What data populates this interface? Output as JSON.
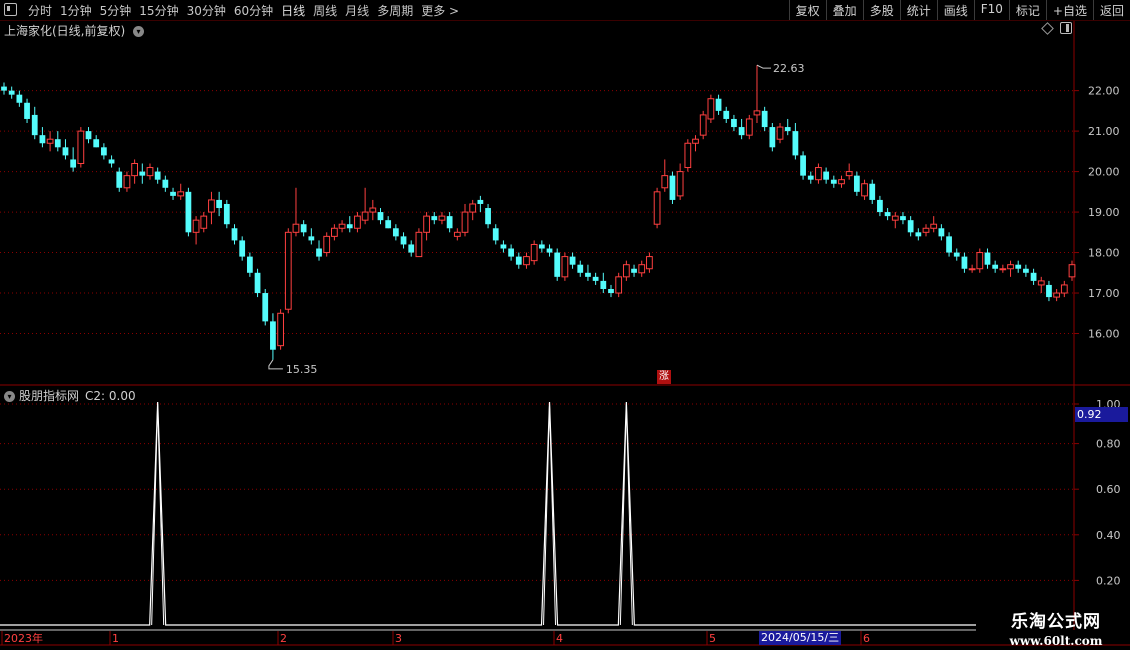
{
  "toolbar": {
    "periods": [
      "分时",
      "1分钟",
      "5分钟",
      "15分钟",
      "30分钟",
      "60分钟",
      "日线",
      "周线",
      "月线",
      "多周期"
    ],
    "active_period": "日线",
    "more_label": "更多 >",
    "tools": [
      "复权",
      "叠加",
      "多股",
      "统计",
      "画线",
      "F10",
      "标记",
      "+自选",
      "返回"
    ]
  },
  "stock_title": "上海家化(日线,前复权)",
  "indicator": {
    "name": "股朋指标网",
    "c2_label": "C2: 0.00"
  },
  "right_badge": "0.92",
  "zhang_label": "涨",
  "watermark": {
    "line1": "乐淘公式网",
    "line2": "www.60lt.com"
  },
  "cursor_date": "2024/05/15/三",
  "colors": {
    "up": "#ff4040",
    "down": "#54fcfc",
    "grid": "#8b0000",
    "axis": "#8b0000",
    "signal": "#ffffff"
  },
  "chart_data": [
    {
      "type": "candlestick",
      "title": "上海家化(日线,前复权)",
      "ylim": [
        15.0,
        23.3
      ],
      "y_ticks": [
        "16.00",
        "17.00",
        "18.00",
        "19.00",
        "20.00",
        "21.00",
        "22.00"
      ],
      "grid": true,
      "annotations": {
        "max": "22.63",
        "min": "15.35"
      },
      "ohlc": [
        [
          22.1,
          22.2,
          21.9,
          22.0
        ],
        [
          22.0,
          22.1,
          21.8,
          21.9
        ],
        [
          21.9,
          22.0,
          21.6,
          21.7
        ],
        [
          21.7,
          21.8,
          21.2,
          21.3
        ],
        [
          21.4,
          21.6,
          20.8,
          20.9
        ],
        [
          20.9,
          21.1,
          20.6,
          20.7
        ],
        [
          20.7,
          21.0,
          20.5,
          20.8
        ],
        [
          20.8,
          21.0,
          20.5,
          20.6
        ],
        [
          20.6,
          20.8,
          20.3,
          20.4
        ],
        [
          20.3,
          20.6,
          20.0,
          20.1
        ],
        [
          20.2,
          21.1,
          20.1,
          21.0
        ],
        [
          21.0,
          21.1,
          20.7,
          20.8
        ],
        [
          20.8,
          20.9,
          20.6,
          20.6
        ],
        [
          20.6,
          20.7,
          20.3,
          20.4
        ],
        [
          20.3,
          20.4,
          20.1,
          20.2
        ],
        [
          20.0,
          20.1,
          19.5,
          19.6
        ],
        [
          19.6,
          20.0,
          19.5,
          19.9
        ],
        [
          19.9,
          20.3,
          19.7,
          20.2
        ],
        [
          20.0,
          20.2,
          19.7,
          19.9
        ],
        [
          19.9,
          20.2,
          19.8,
          20.1
        ],
        [
          20.0,
          20.1,
          19.7,
          19.8
        ],
        [
          19.8,
          19.9,
          19.5,
          19.6
        ],
        [
          19.5,
          19.6,
          19.3,
          19.4
        ],
        [
          19.4,
          19.7,
          19.3,
          19.5
        ],
        [
          19.5,
          19.6,
          18.4,
          18.5
        ],
        [
          18.5,
          18.9,
          18.2,
          18.8
        ],
        [
          18.6,
          19.0,
          18.5,
          18.9
        ],
        [
          19.0,
          19.5,
          18.7,
          19.3
        ],
        [
          19.3,
          19.5,
          18.9,
          19.1
        ],
        [
          19.2,
          19.3,
          18.6,
          18.7
        ],
        [
          18.6,
          18.7,
          18.2,
          18.3
        ],
        [
          18.3,
          18.4,
          17.8,
          17.9
        ],
        [
          17.9,
          18.0,
          17.4,
          17.5
        ],
        [
          17.5,
          17.6,
          16.9,
          17.0
        ],
        [
          17.0,
          17.1,
          16.2,
          16.3
        ],
        [
          16.3,
          16.5,
          15.35,
          15.6
        ],
        [
          15.7,
          16.6,
          15.6,
          16.5
        ],
        [
          16.6,
          18.6,
          16.5,
          18.5
        ],
        [
          18.5,
          19.6,
          18.4,
          18.7
        ],
        [
          18.7,
          18.8,
          18.4,
          18.5
        ],
        [
          18.4,
          18.6,
          18.2,
          18.3
        ],
        [
          18.1,
          18.3,
          17.8,
          17.9
        ],
        [
          18.0,
          18.5,
          17.9,
          18.4
        ],
        [
          18.4,
          18.7,
          18.3,
          18.6
        ],
        [
          18.6,
          18.8,
          18.5,
          18.7
        ],
        [
          18.7,
          18.9,
          18.5,
          18.6
        ],
        [
          18.6,
          19.0,
          18.5,
          18.9
        ],
        [
          18.8,
          19.6,
          18.7,
          19.0
        ],
        [
          19.0,
          19.3,
          18.8,
          19.1
        ],
        [
          19.0,
          19.1,
          18.7,
          18.8
        ],
        [
          18.8,
          18.9,
          18.6,
          18.6
        ],
        [
          18.6,
          18.7,
          18.3,
          18.4
        ],
        [
          18.4,
          18.5,
          18.1,
          18.2
        ],
        [
          18.2,
          18.3,
          17.9,
          18.0
        ],
        [
          17.9,
          18.6,
          17.9,
          18.5
        ],
        [
          18.5,
          19.0,
          18.3,
          18.9
        ],
        [
          18.9,
          19.0,
          18.7,
          18.8
        ],
        [
          18.8,
          19.0,
          18.7,
          18.9
        ],
        [
          18.9,
          19.0,
          18.5,
          18.6
        ],
        [
          18.4,
          18.6,
          18.3,
          18.5
        ],
        [
          18.5,
          19.2,
          18.4,
          19.0
        ],
        [
          19.0,
          19.3,
          18.8,
          19.2
        ],
        [
          19.3,
          19.4,
          19.0,
          19.2
        ],
        [
          19.1,
          19.2,
          18.6,
          18.7
        ],
        [
          18.6,
          18.7,
          18.2,
          18.3
        ],
        [
          18.2,
          18.3,
          18.0,
          18.1
        ],
        [
          18.1,
          18.2,
          17.8,
          17.9
        ],
        [
          17.9,
          18.0,
          17.6,
          17.7
        ],
        [
          17.7,
          18.0,
          17.6,
          17.9
        ],
        [
          17.8,
          18.3,
          17.7,
          18.2
        ],
        [
          18.2,
          18.3,
          18.0,
          18.1
        ],
        [
          18.1,
          18.2,
          17.9,
          18.0
        ],
        [
          18.0,
          18.1,
          17.3,
          17.4
        ],
        [
          17.4,
          18.0,
          17.3,
          17.9
        ],
        [
          17.9,
          18.0,
          17.6,
          17.7
        ],
        [
          17.7,
          17.8,
          17.4,
          17.5
        ],
        [
          17.5,
          17.7,
          17.3,
          17.4
        ],
        [
          17.4,
          17.5,
          17.2,
          17.3
        ],
        [
          17.3,
          17.5,
          17.0,
          17.1
        ],
        [
          17.1,
          17.2,
          16.9,
          17.0
        ],
        [
          17.0,
          17.5,
          16.9,
          17.4
        ],
        [
          17.4,
          17.8,
          17.3,
          17.7
        ],
        [
          17.6,
          17.7,
          17.4,
          17.5
        ],
        [
          17.5,
          17.8,
          17.4,
          17.7
        ],
        [
          17.6,
          18.0,
          17.5,
          17.9
        ],
        [
          18.7,
          19.6,
          18.6,
          19.5
        ],
        [
          19.6,
          20.3,
          19.5,
          19.9
        ],
        [
          19.9,
          20.0,
          19.2,
          19.3
        ],
        [
          19.4,
          20.2,
          19.3,
          20.0
        ],
        [
          20.1,
          20.8,
          20.0,
          20.7
        ],
        [
          20.7,
          20.9,
          20.5,
          20.8
        ],
        [
          20.9,
          21.5,
          20.8,
          21.4
        ],
        [
          21.3,
          21.9,
          21.2,
          21.8
        ],
        [
          21.8,
          21.9,
          21.4,
          21.5
        ],
        [
          21.5,
          21.6,
          21.2,
          21.3
        ],
        [
          21.3,
          21.4,
          21.0,
          21.1
        ],
        [
          21.1,
          21.3,
          20.8,
          20.9
        ],
        [
          20.9,
          21.4,
          20.8,
          21.3
        ],
        [
          21.4,
          22.63,
          21.2,
          21.5
        ],
        [
          21.5,
          21.6,
          21.0,
          21.1
        ],
        [
          21.1,
          21.2,
          20.5,
          20.6
        ],
        [
          20.8,
          21.2,
          20.7,
          21.1
        ],
        [
          21.1,
          21.3,
          20.9,
          21.0
        ],
        [
          21.0,
          21.2,
          20.3,
          20.4
        ],
        [
          20.4,
          20.5,
          19.8,
          19.9
        ],
        [
          19.9,
          20.0,
          19.7,
          19.8
        ],
        [
          19.8,
          20.2,
          19.7,
          20.1
        ],
        [
          20.0,
          20.1,
          19.7,
          19.8
        ],
        [
          19.8,
          19.9,
          19.6,
          19.7
        ],
        [
          19.7,
          19.9,
          19.6,
          19.8
        ],
        [
          19.9,
          20.2,
          19.8,
          20.0
        ],
        [
          19.9,
          20.0,
          19.4,
          19.5
        ],
        [
          19.4,
          19.8,
          19.3,
          19.7
        ],
        [
          19.7,
          19.8,
          19.2,
          19.3
        ],
        [
          19.3,
          19.4,
          18.9,
          19.0
        ],
        [
          19.0,
          19.1,
          18.8,
          18.9
        ],
        [
          18.8,
          19.0,
          18.6,
          18.9
        ],
        [
          18.9,
          19.0,
          18.7,
          18.8
        ],
        [
          18.8,
          18.9,
          18.4,
          18.5
        ],
        [
          18.5,
          18.6,
          18.3,
          18.4
        ],
        [
          18.5,
          18.7,
          18.4,
          18.6
        ],
        [
          18.6,
          18.9,
          18.5,
          18.7
        ],
        [
          18.6,
          18.7,
          18.3,
          18.4
        ],
        [
          18.4,
          18.5,
          17.9,
          18.0
        ],
        [
          18.0,
          18.1,
          17.8,
          17.9
        ],
        [
          17.9,
          18.0,
          17.5,
          17.6
        ],
        [
          17.6,
          17.7,
          17.5,
          17.6
        ],
        [
          17.6,
          18.1,
          17.5,
          18.0
        ],
        [
          18.0,
          18.1,
          17.6,
          17.7
        ],
        [
          17.7,
          17.8,
          17.5,
          17.6
        ],
        [
          17.6,
          17.7,
          17.5,
          17.6
        ],
        [
          17.6,
          17.8,
          17.4,
          17.7
        ],
        [
          17.7,
          17.8,
          17.5,
          17.6
        ],
        [
          17.6,
          17.7,
          17.4,
          17.5
        ],
        [
          17.5,
          17.6,
          17.2,
          17.3
        ],
        [
          17.2,
          17.4,
          17.0,
          17.3
        ],
        [
          17.2,
          17.3,
          16.8,
          16.9
        ],
        [
          16.9,
          17.1,
          16.8,
          17.0
        ],
        [
          17.0,
          17.3,
          16.9,
          17.2
        ],
        [
          17.4,
          17.8,
          17.3,
          17.7
        ]
      ]
    },
    {
      "type": "line",
      "title": "股朋指标网",
      "ylim": [
        0,
        1.0
      ],
      "y_ticks": [
        "0.20",
        "0.40",
        "0.60",
        "0.80",
        "1.00"
      ],
      "x_labels": [
        "2023年",
        "1",
        "2",
        "3",
        "4",
        "5",
        "6"
      ],
      "series": [
        {
          "name": "C2",
          "values": [
            0,
            0,
            0,
            0,
            0,
            0,
            0,
            0,
            0,
            0,
            0,
            0,
            0,
            0,
            0,
            0,
            0,
            0,
            0,
            0,
            0,
            0,
            0,
            0,
            0,
            0,
            0,
            0,
            0,
            0,
            0,
            0,
            0,
            0,
            0,
            0,
            0,
            0,
            0,
            0,
            0,
            0,
            0,
            0,
            0,
            0,
            0,
            0,
            0,
            0,
            0,
            0,
            0,
            0,
            0,
            0,
            0,
            0,
            0,
            0,
            0,
            0,
            0,
            0,
            0,
            0,
            0,
            0,
            0,
            0,
            0,
            0,
            0,
            0,
            0,
            0,
            0,
            0,
            0,
            0,
            0,
            0,
            0,
            0,
            0,
            0,
            0,
            0,
            0,
            0,
            0,
            0,
            0,
            0,
            0,
            0,
            0,
            0,
            0,
            0,
            0,
            0,
            0,
            0,
            0,
            0,
            0,
            0,
            0,
            0,
            0,
            0,
            0,
            0,
            0,
            0,
            0,
            0,
            0,
            0,
            0,
            0,
            0,
            0,
            0,
            0,
            0,
            0,
            0,
            0,
            0,
            0,
            0,
            0,
            0,
            0,
            0,
            0,
            0,
            0,
            0,
            0,
            0,
            0,
            0,
            0,
            0,
            0,
            0,
            0
          ],
          "spikes": [
            20,
            71,
            81
          ]
        }
      ]
    }
  ]
}
